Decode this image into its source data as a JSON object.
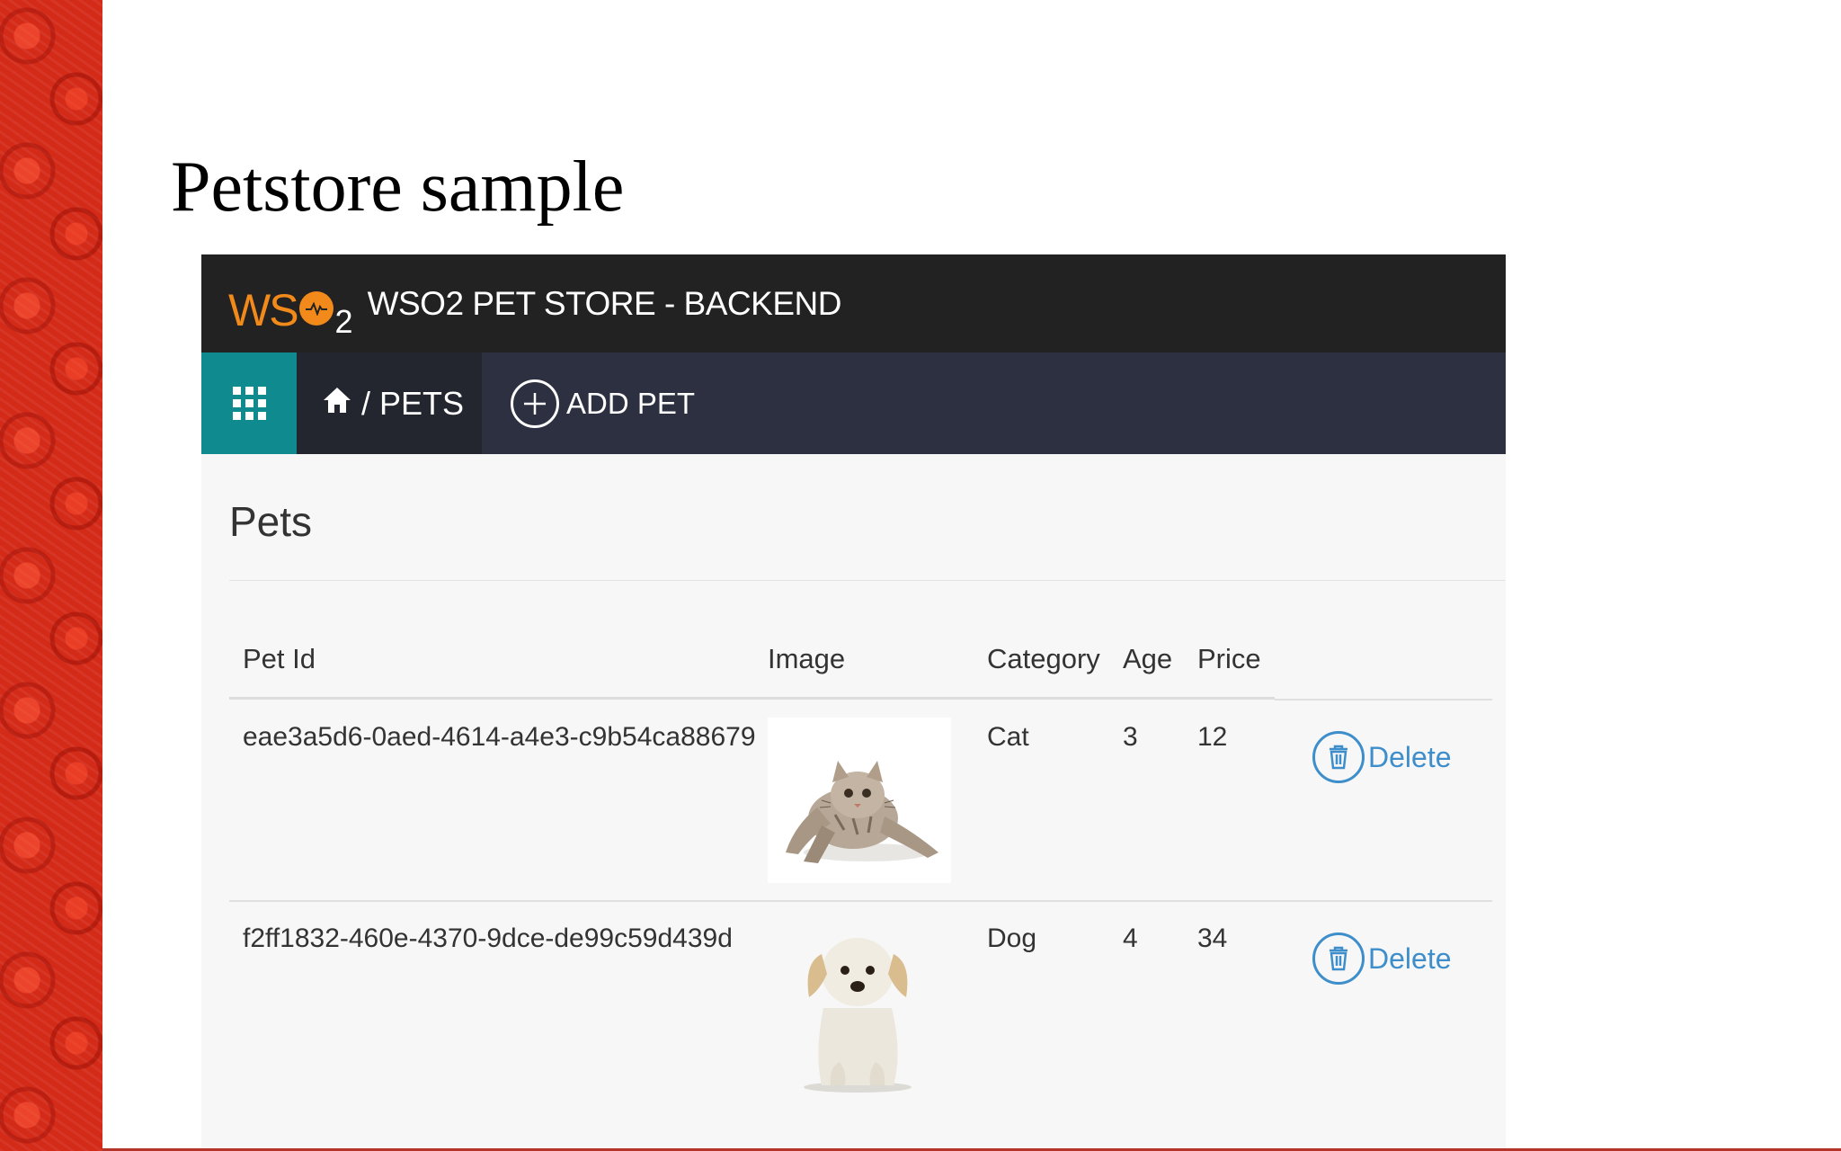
{
  "slide": {
    "title": "Petstore sample"
  },
  "header": {
    "logo_text": "WS",
    "logo_sub": "2",
    "app_title": "WSO2 PET STORE - BACKEND"
  },
  "nav": {
    "breadcrumb_separator": "/",
    "breadcrumb_current": "PETS",
    "add_pet_label": "ADD PET"
  },
  "page": {
    "title": "Pets"
  },
  "table": {
    "columns": [
      "Pet Id",
      "Image",
      "Category",
      "Age",
      "Price"
    ],
    "rows": [
      {
        "pet_id": "eae3a5d6-0aed-4614-a4e3-c9b54ca88679",
        "image": "cat",
        "category": "Cat",
        "age": "3",
        "price": "12",
        "action": "Delete"
      },
      {
        "pet_id": "f2ff1832-460e-4370-9dce-de99c59d439d",
        "image": "dog",
        "category": "Dog",
        "age": "4",
        "price": "34",
        "action": "Delete"
      }
    ]
  },
  "colors": {
    "header_bg": "#222222",
    "nav_bg": "#2c3040",
    "grid_button_bg": "#0f8a8f",
    "logo_orange": "#f28a1b",
    "delete_blue": "#3d8ecb"
  },
  "icons": [
    "apps-grid-icon",
    "home-icon",
    "plus-circle-icon",
    "trash-icon"
  ]
}
